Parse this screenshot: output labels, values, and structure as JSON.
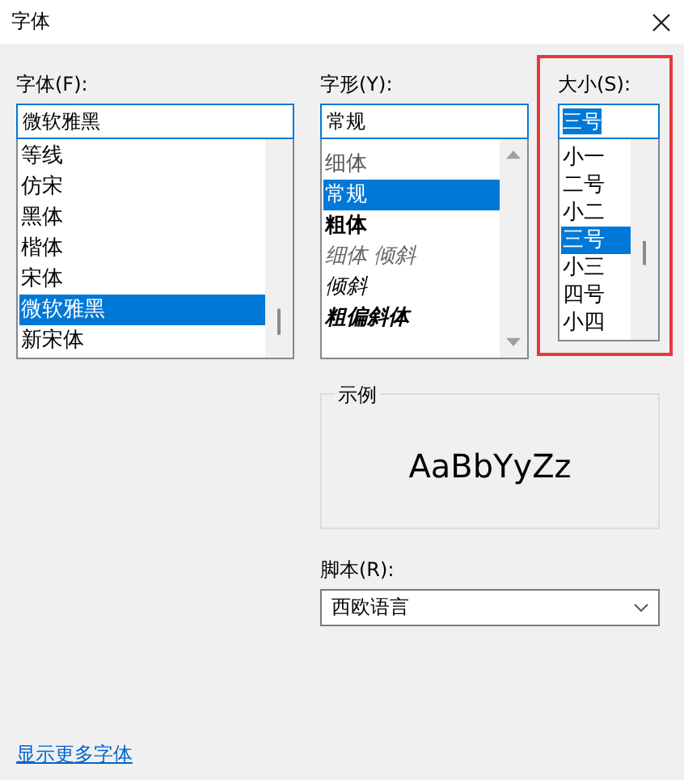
{
  "window": {
    "title": "字体"
  },
  "font": {
    "label": "字体(F):",
    "value": "微软雅黑",
    "items": [
      {
        "label": "等线",
        "selected": false
      },
      {
        "label": "仿宋",
        "selected": false
      },
      {
        "label": "黑体",
        "selected": false
      },
      {
        "label": "楷体",
        "selected": false
      },
      {
        "label": "宋体",
        "selected": false
      },
      {
        "label": "微软雅黑",
        "selected": true
      },
      {
        "label": "新宋体",
        "selected": false
      }
    ]
  },
  "style": {
    "label": "字形(Y):",
    "value": "常规",
    "items": [
      {
        "label": "细体",
        "kind": "light",
        "selected": false
      },
      {
        "label": "常规",
        "kind": "regular",
        "selected": true
      },
      {
        "label": "粗体",
        "kind": "bold",
        "selected": false
      },
      {
        "label": "细体 倾斜",
        "kind": "light-italic",
        "selected": false
      },
      {
        "label": "倾斜",
        "kind": "italic",
        "selected": false
      },
      {
        "label": "粗偏斜体",
        "kind": "bold-italic",
        "selected": false
      }
    ]
  },
  "size": {
    "label": "大小(S):",
    "value": "三号",
    "highlighted": true,
    "items": [
      {
        "label": "小一",
        "selected": false
      },
      {
        "label": "二号",
        "selected": false
      },
      {
        "label": "小二",
        "selected": false
      },
      {
        "label": "三号",
        "selected": true
      },
      {
        "label": "小三",
        "selected": false
      },
      {
        "label": "四号",
        "selected": false
      },
      {
        "label": "小四",
        "selected": false
      }
    ]
  },
  "sample": {
    "label": "示例",
    "text": "AaBbYyZz"
  },
  "script": {
    "label": "脚本(R):",
    "value": "西欧语言"
  },
  "link": "显示更多字体"
}
